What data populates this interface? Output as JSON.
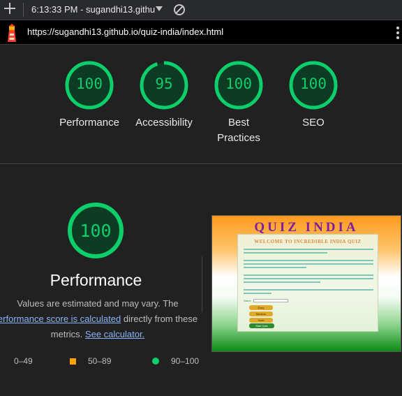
{
  "toolbar": {
    "report_title": "6:13:33 PM - sugandhi13.githu"
  },
  "urlbar": {
    "url": "https://sugandhi13.github.io/quiz-india/index.html"
  },
  "summary": [
    {
      "score": "100",
      "label": "Performance",
      "value": 100
    },
    {
      "score": "95",
      "label": "Accessibility",
      "value": 95
    },
    {
      "score": "100",
      "label": "Best Practices",
      "value": 100
    },
    {
      "score": "100",
      "label": "SEO",
      "value": 100
    }
  ],
  "performance": {
    "score": "100",
    "value": 100,
    "title": "Performance",
    "desc_line1": "Values are estimated and may vary. The",
    "desc_link1": "erformance score is calculated",
    "desc_mid": " directly from these",
    "desc_line3_pre": "metrics. ",
    "desc_link2": "See calculator."
  },
  "legend": {
    "fail": "0–49",
    "average": "50–89",
    "pass": "90–100"
  },
  "colors": {
    "pass": "#0cce6b",
    "average": "#ffa400",
    "fail": "#ff4e42"
  },
  "thumbnail": {
    "title": "QUIZ INDIA",
    "heading": "WELCOME TO INCREDIBLE INDIA QUIZ",
    "name_label": "Name",
    "buttons": [
      "Easy",
      "Medium",
      "Hard"
    ],
    "start": "Start Quiz"
  }
}
